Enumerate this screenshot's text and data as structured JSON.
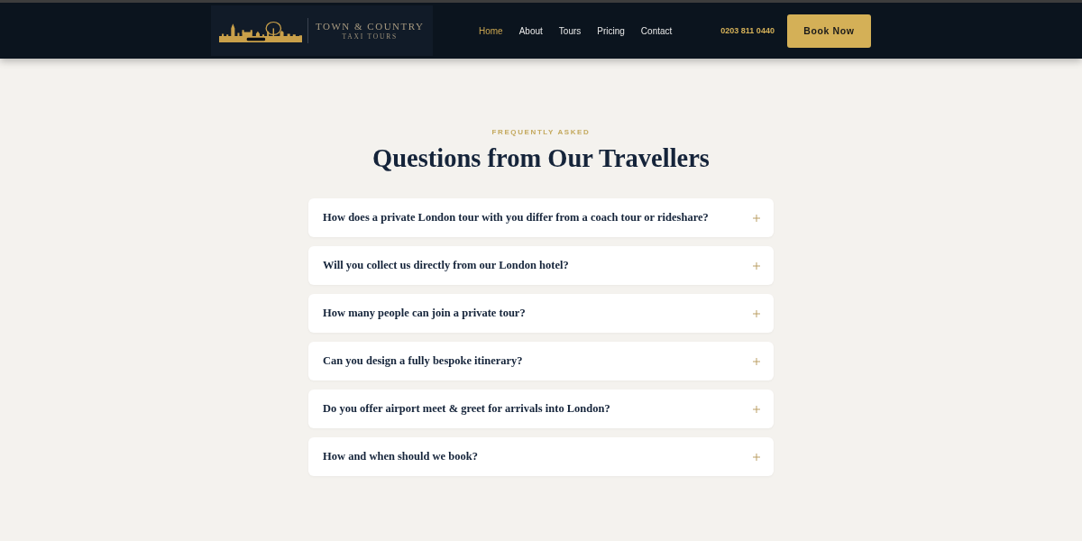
{
  "header": {
    "logo": {
      "title": "TOWN & COUNTRY",
      "subtitle": "TAXI TOURS"
    },
    "nav": [
      {
        "label": "Home",
        "selected": true
      },
      {
        "label": "About",
        "selected": false
      },
      {
        "label": "Tours",
        "selected": false
      },
      {
        "label": "Pricing",
        "selected": false
      },
      {
        "label": "Contact",
        "selected": false
      }
    ],
    "phone": "0203 811 0440",
    "cta": "Book Now"
  },
  "faq": {
    "eyebrow": "FREQUENTLY ASKED",
    "title": "Questions from Our Travellers",
    "items": [
      {
        "question": "How does a private London tour with you differ from a coach tour or rideshare?",
        "expanded": false
      },
      {
        "question": "Will you collect us directly from our London hotel?",
        "expanded": false
      },
      {
        "question": "How many people can join a private tour?",
        "expanded": false
      },
      {
        "question": "Can you design a fully bespoke itinerary?",
        "expanded": false
      },
      {
        "question": "Do you offer airport meet & greet for arrivals into London?",
        "expanded": false
      },
      {
        "question": "How and when should we book?",
        "expanded": false
      }
    ]
  }
}
